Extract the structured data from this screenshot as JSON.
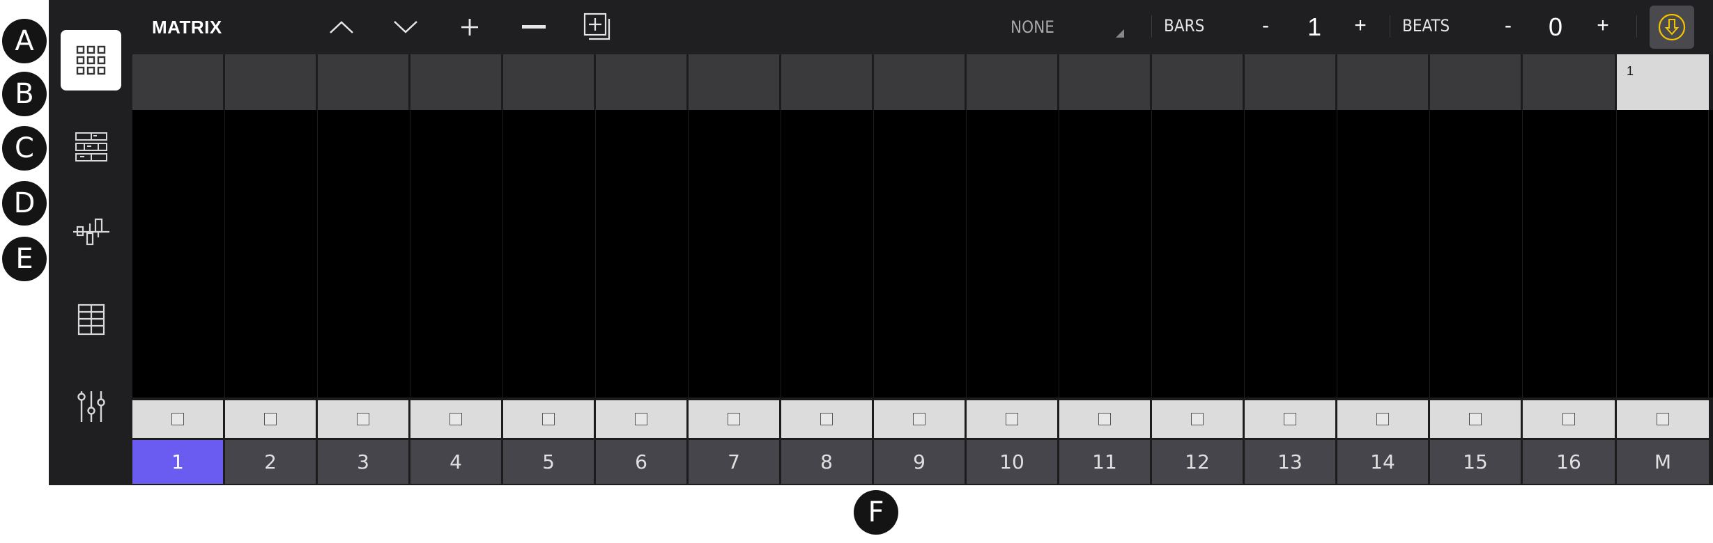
{
  "callouts": {
    "a": "A",
    "b": "B",
    "c": "C",
    "d": "D",
    "e": "E",
    "f": "F"
  },
  "toolbar": {
    "title": "MATRIX",
    "icons": [
      "chevron-up-icon",
      "chevron-down-icon",
      "plus-icon",
      "minus-icon",
      "add-layer-icon"
    ],
    "quantize": "NONE",
    "bars_label": "BARS",
    "bars_minus": "-",
    "bars_value": "1",
    "bars_plus": "+",
    "beats_label": "BEATS",
    "beats_minus": "-",
    "beats_value": "0",
    "beats_plus": "+",
    "download_icon": "download-icon"
  },
  "sidebar": {
    "items": [
      {
        "icon": "grid-icon",
        "active": true
      },
      {
        "icon": "sequencer-icon",
        "active": false
      },
      {
        "icon": "step-icon",
        "active": false
      },
      {
        "icon": "list-icon",
        "active": false
      },
      {
        "icon": "mixer-icon",
        "active": false
      }
    ]
  },
  "grid": {
    "master_header": "1",
    "columns": [
      "1",
      "2",
      "3",
      "4",
      "5",
      "6",
      "7",
      "8",
      "9",
      "10",
      "11",
      "12",
      "13",
      "14",
      "15",
      "16",
      "M"
    ],
    "selected_column": "1"
  },
  "colors": {
    "accent": "#6a5cf0",
    "download_icon": "#f5c400",
    "background": "#1b1b1e"
  }
}
